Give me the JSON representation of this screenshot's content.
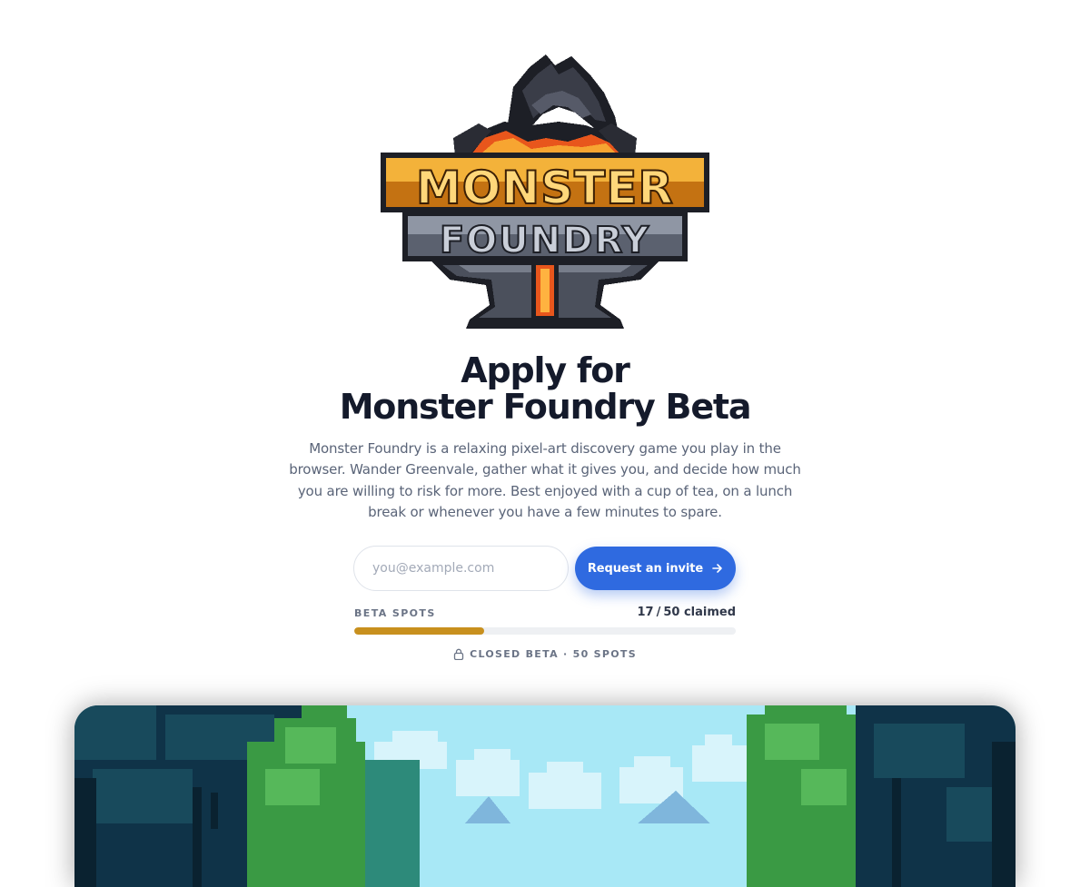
{
  "logo": {
    "line1": "MONSTER",
    "line2": "FOUNDRY",
    "numeral": "I",
    "colors": {
      "gold": "#f0a020",
      "steel": "#6b7280",
      "dark": "#1d1f26",
      "lava": "#e8561c"
    }
  },
  "hero": {
    "title_line1": "Apply for",
    "title_line2": "Monster Foundry Beta",
    "description": "Monster Foundry is a relaxing pixel-art discovery game you play in the browser. Wander Greenvale, gather what it gives you, and decide how much you are willing to risk for more. Best enjoyed with a cup of tea, on a lunch break or whenever you have a few minutes to spare."
  },
  "form": {
    "email_placeholder": "you@example.com",
    "email_value": "",
    "submit_label": "Request an invite",
    "submit_icon": "arrow-right-icon"
  },
  "beta": {
    "spots_label": "BETA SPOTS",
    "claimed": "17",
    "total": "50",
    "claimed_suffix": "claimed",
    "progress_fraction": 0.34,
    "status_icon": "lock-icon",
    "status_text": "CLOSED BETA · 50 SPOTS"
  },
  "colors": {
    "accent": "#2f6ae0",
    "progress": "#c8901e",
    "heading": "#141a2b",
    "body": "#5a6478"
  }
}
